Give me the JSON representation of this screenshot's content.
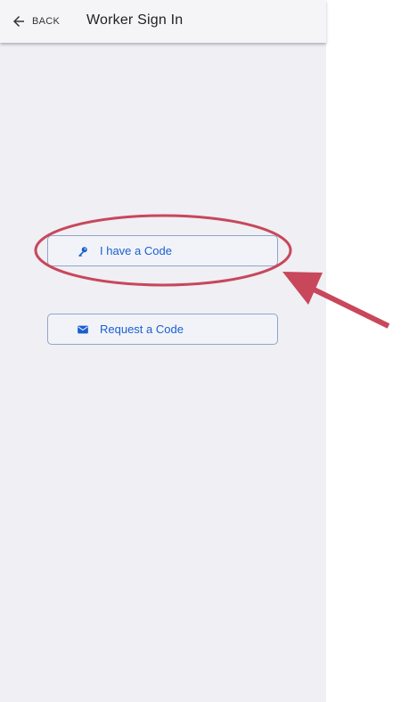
{
  "header": {
    "back_label": "BACK",
    "title": "Worker Sign In"
  },
  "actions": {
    "have_code_label": "I have a Code",
    "request_code_label": "Request a Code"
  },
  "icons": {
    "back": "arrow-left-icon",
    "have_code": "key-icon",
    "request_code": "envelope-icon"
  },
  "colors": {
    "accent": "#1a5fd1",
    "annotation": "#c8475a",
    "screen_background": "#efeff4"
  }
}
